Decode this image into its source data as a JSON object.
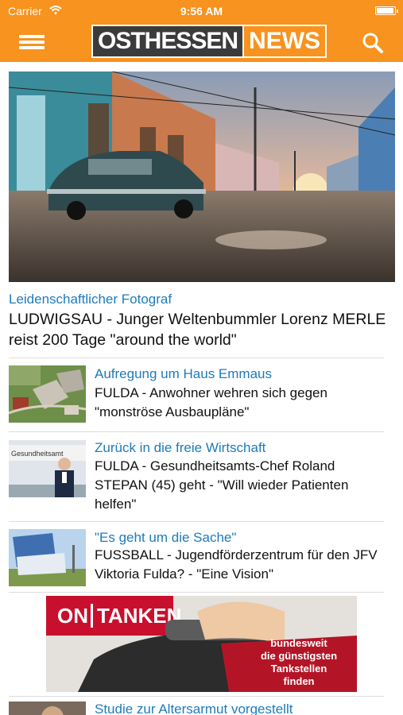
{
  "statusbar": {
    "carrier": "Carrier",
    "time": "9:56 AM"
  },
  "header": {
    "logo_part1": "OSTHESSEN",
    "logo_part2": "NEWS",
    "menu_icon": "hamburger-menu-icon",
    "search_icon": "search-icon"
  },
  "colors": {
    "brand_orange": "#f7931e",
    "link_blue": "#1e7bb8",
    "logo_dark": "#3b3b3b"
  },
  "hero": {
    "kicker": "Leidenschaftlicher Fotograf",
    "title": "LUDWIGSAU - Junger Weltenbummler Lorenz MERLE reist 200 Tage \"around the world\""
  },
  "articles": [
    {
      "kicker": "Aufregung um Haus Emmaus",
      "title": "FULDA - Anwohner wehren sich gegen \"monströse Ausbaupläne\""
    },
    {
      "kicker": "Zurück in die freie Wirtschaft",
      "title": "FULDA - Gesundheitsamts-Chef Roland STEPAN (45) geht - \"Will wieder Patienten helfen\"",
      "thumb_sign": "Gesundheitsamt"
    },
    {
      "kicker": "\"Es geht um die Sache\"",
      "title": "FUSSBALL - Jugendförderzentrum für den JFV Viktoria Fulda? - \"Eine Vision\""
    },
    {
      "kicker": "Studie zur Altersarmut vorgestellt"
    }
  ],
  "ad": {
    "brand_left": "ON",
    "brand_right": "TANKEN",
    "slogan_1": "bundesweit",
    "slogan_2": "die günstigsten",
    "slogan_3": "Tankstellen",
    "slogan_4": "finden"
  }
}
